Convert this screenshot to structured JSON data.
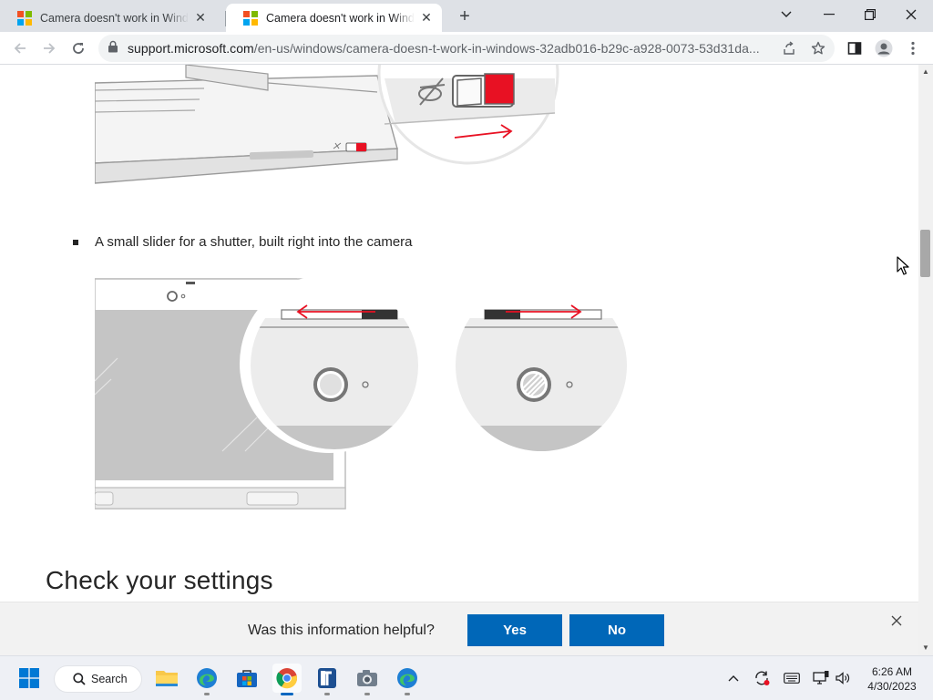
{
  "browser": {
    "tabs": [
      {
        "title": "Camera doesn't work in Windows 10",
        "state": "inactive"
      },
      {
        "title": "Camera doesn't work in Windows 10",
        "state": "active"
      }
    ],
    "address_bar": {
      "url_host": "support.microsoft.com",
      "url_path": "/en-us/windows/camera-doesn-t-work-in-windows-32adb016-b29c-a928-0073-53d31da..."
    }
  },
  "article": {
    "bullet_text": "A small slider for a shutter, built right into the camera",
    "section_heading": "Check your settings"
  },
  "feedback": {
    "question": "Was this information helpful?",
    "yes_label": "Yes",
    "no_label": "No"
  },
  "taskbar": {
    "search_label": "Search",
    "time": "6:26 AM",
    "date": "4/30/2023",
    "pinned_apps": [
      "start-icon",
      "search",
      "file-explorer-icon",
      "edge-icon",
      "store-icon",
      "chrome-icon",
      "app-icon",
      "camera-icon",
      "edge-dev-icon"
    ]
  },
  "colors": {
    "accent_blue": "#0067b8",
    "shutter_red": "#e81123",
    "ms_red": "#f25022",
    "ms_green": "#7fba00",
    "ms_blue": "#00a4ef",
    "ms_yellow": "#ffb900"
  }
}
